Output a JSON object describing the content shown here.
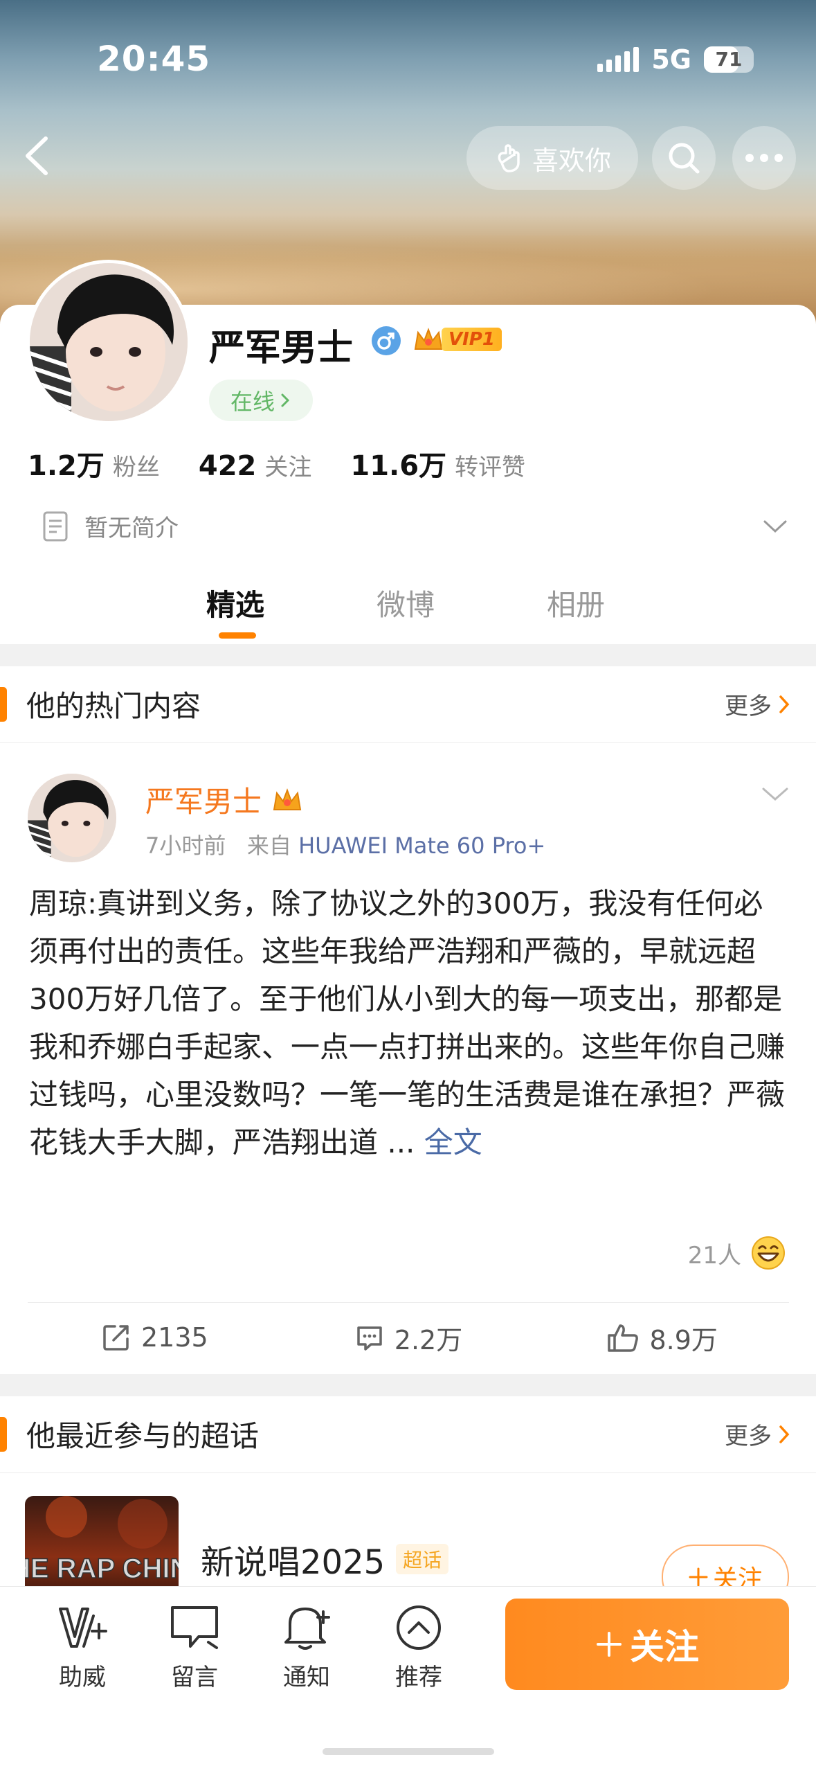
{
  "status_bar": {
    "time": "20:45",
    "network": "5G",
    "battery": "71"
  },
  "header": {
    "like_button": "喜欢你"
  },
  "profile": {
    "name": "严军男士",
    "vip_label": "VIP1",
    "online": "在线",
    "stats": [
      {
        "value": "1.2万",
        "label": "粉丝"
      },
      {
        "value": "422",
        "label": "关注"
      },
      {
        "value": "11.6万",
        "label": "转评赞"
      }
    ],
    "bio": "暂无简介"
  },
  "tabs": [
    {
      "label": "精选",
      "active": true
    },
    {
      "label": "微博",
      "active": false
    },
    {
      "label": "相册",
      "active": false
    }
  ],
  "hot_section": {
    "title": "他的热门内容",
    "more": "更多"
  },
  "post": {
    "author": "严军男士",
    "time": "7小时前",
    "source_prefix": "来自",
    "source": "HUAWEI Mate 60 Pro+",
    "text": "周琼:真讲到义务，除了协议之外的300万，我没有任何必须再付出的责任。这些年我给严浩翔和严薇的，早就远超300万好几倍了。至于他们从小到大的每一项支出，那都是我和乔娜白手起家、一点一点打拼出来的。这些年你自己赚过钱吗，心里没数吗？一笔一笔的生活费是谁在承担？严薇花钱大手大脚，严浩翔出道 ...",
    "full_text_link": "全文",
    "reactors": "21人",
    "reposts": "2135",
    "comments": "2.2万",
    "likes": "8.9万"
  },
  "topic_section": {
    "title": "他最近参与的超话",
    "more": "更多"
  },
  "topic": {
    "name": "新说唱2025",
    "tag": "超话",
    "follow": "关注",
    "image_text": "THE RAP CHINA"
  },
  "bottom_bar": {
    "items": [
      {
        "label": "助威",
        "icon": "cheer-icon"
      },
      {
        "label": "留言",
        "icon": "message-icon"
      },
      {
        "label": "通知",
        "icon": "bell-icon"
      },
      {
        "label": "推荐",
        "icon": "recommend-icon"
      }
    ],
    "follow": "关注"
  },
  "colors": {
    "accent": "#ff8200",
    "name_orange": "#f5781f",
    "link_blue": "#4a6aa6",
    "online_green": "#62b766"
  }
}
